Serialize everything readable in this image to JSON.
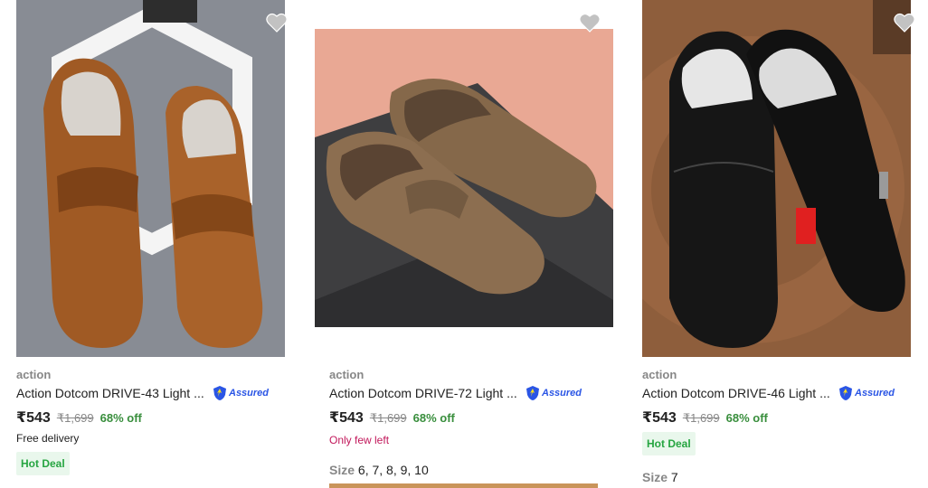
{
  "products": [
    {
      "brand": "action",
      "title": "Action Dotcom DRIVE-43 Light ...",
      "assured_label": "Assured",
      "price": "₹543",
      "mrp": "₹1,699",
      "discount": "68% off",
      "note": "Free delivery",
      "note_color": "#212121",
      "deal": "Hot Deal",
      "image_icon": "brown-loafers-photo"
    },
    {
      "brand": "action",
      "title": "Action Dotcom DRIVE-72 Light ...",
      "assured_label": "Assured",
      "price": "₹543",
      "mrp": "₹1,699",
      "discount": "68% off",
      "note": "Only few left",
      "note_color": "#c2185b",
      "size_label": "Size",
      "sizes": "6, 7, 8, 9, 10",
      "image_icon": "olive-loafers-photo"
    },
    {
      "brand": "action",
      "title": "Action Dotcom DRIVE-46 Light ...",
      "assured_label": "Assured",
      "price": "₹543",
      "mrp": "₹1,699",
      "discount": "68% off",
      "deal": "Hot Deal",
      "size_label": "Size",
      "sizes": "7",
      "image_icon": "black-loafers-photo"
    }
  ],
  "colors": {
    "accent_green": "#388e3c",
    "deal_bg": "#e9f7ec",
    "assured_blue": "#2a55e5",
    "muted": "#878787"
  }
}
